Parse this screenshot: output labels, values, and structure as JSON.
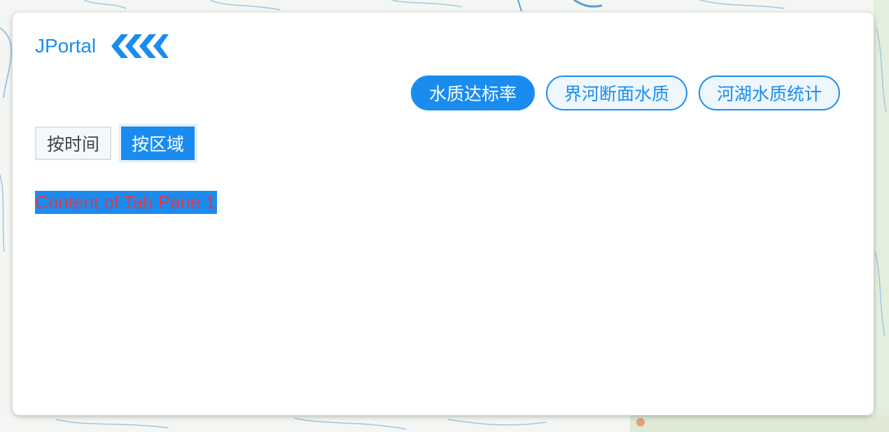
{
  "app": {
    "title": "JPortal",
    "collapse_icon": "double-chevron-left-icon"
  },
  "category_tabs": [
    {
      "label": "水质达标率",
      "active": true
    },
    {
      "label": "界河断面水质",
      "active": false
    },
    {
      "label": "河湖水质统计",
      "active": false
    }
  ],
  "sub_tabs": [
    {
      "label": "按时间",
      "active": false
    },
    {
      "label": "按区域",
      "active": true
    }
  ],
  "content": {
    "text": "Content of Tab Pane 1"
  },
  "colors": {
    "accent": "#1a8cf0",
    "content_text": "#e03a4a",
    "panel_bg": "#ffffff"
  }
}
